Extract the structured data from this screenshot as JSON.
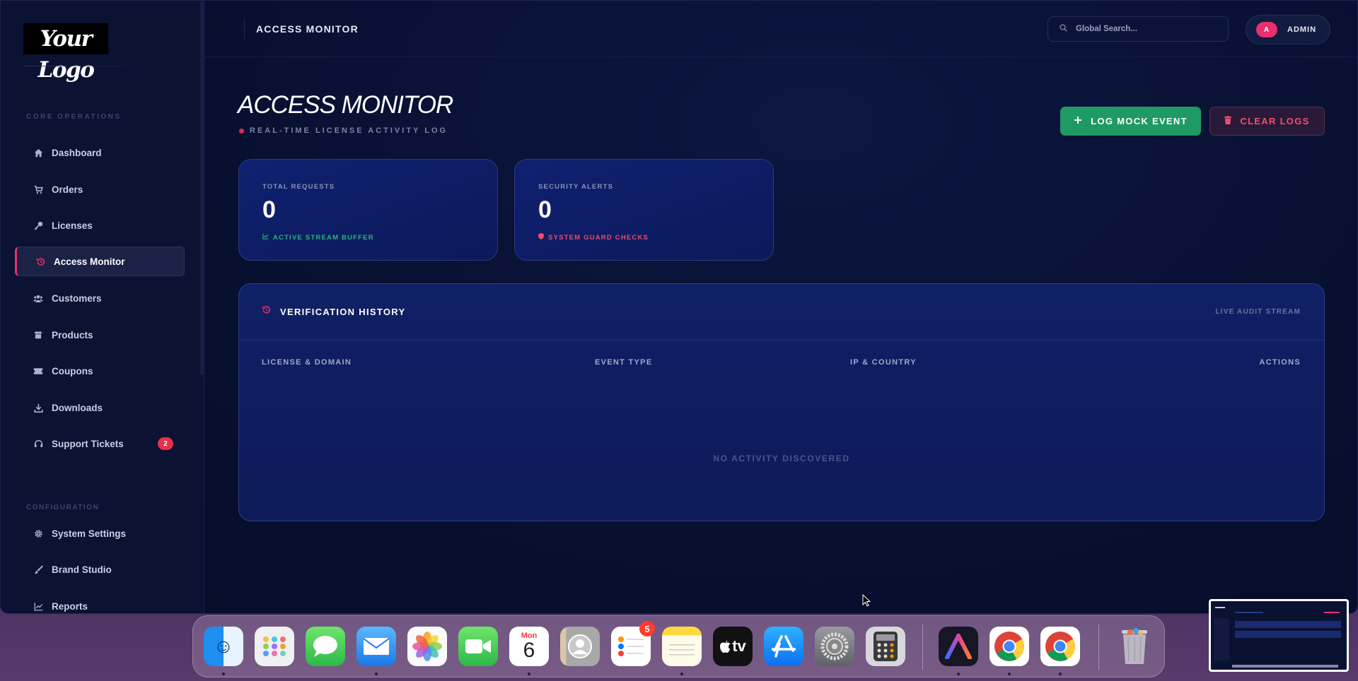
{
  "app": {
    "logo_text": "Your Logo"
  },
  "sidebar": {
    "section_core": "CORE OPERATIONS",
    "section_config": "CONFIGURATION",
    "items": [
      {
        "label": "Dashboard",
        "icon": "home-icon"
      },
      {
        "label": "Orders",
        "icon": "cart-icon"
      },
      {
        "label": "Licenses",
        "icon": "key-icon"
      },
      {
        "label": "Access Monitor",
        "icon": "history-icon",
        "active": true
      },
      {
        "label": "Customers",
        "icon": "users-icon"
      },
      {
        "label": "Products",
        "icon": "box-icon"
      },
      {
        "label": "Coupons",
        "icon": "ticket-icon"
      },
      {
        "label": "Downloads",
        "icon": "download-icon"
      },
      {
        "label": "Support Tickets",
        "icon": "headset-icon",
        "badge": "2"
      }
    ],
    "config_items": [
      {
        "label": "System Settings",
        "icon": "gear-icon"
      },
      {
        "label": "Brand Studio",
        "icon": "brush-icon"
      },
      {
        "label": "Reports",
        "icon": "chart-line-icon"
      }
    ]
  },
  "header": {
    "title": "ACCESS MONITOR",
    "search_placeholder": "Global Search...",
    "user_initial": "A",
    "user_label": "ADMIN"
  },
  "main": {
    "title": "ACCESS MONITOR",
    "subtitle": "REAL-TIME LICENSE ACTIVITY LOG",
    "log_button": "LOG MOCK EVENT",
    "clear_button": "CLEAR LOGS",
    "stats": [
      {
        "label": "TOTAL REQUESTS",
        "value": "0",
        "meta": "ACTIVE STREAM BUFFER"
      },
      {
        "label": "SECURITY ALERTS",
        "value": "0",
        "meta": "SYSTEM GUARD CHECKS"
      }
    ],
    "panel": {
      "title": "VERIFICATION HISTORY",
      "right_label": "LIVE AUDIT STREAM",
      "columns": [
        "LICENSE & DOMAIN",
        "EVENT TYPE",
        "IP & COUNTRY",
        "ACTIONS"
      ],
      "empty_text": "NO ACTIVITY DISCOVERED"
    }
  },
  "dock": {
    "calendar_month": "Mon",
    "calendar_day": "6",
    "reminders_badge": "5",
    "tv_label": "tv",
    "apps": [
      "Finder",
      "Launchpad",
      "Messages",
      "Mail",
      "Photos",
      "FaceTime",
      "Calendar",
      "Contacts",
      "Reminders",
      "Notes",
      "TV",
      "App Store",
      "System Settings",
      "Calculator",
      "Arc",
      "Chrome",
      "Chrome",
      "Trash"
    ]
  },
  "colors": {
    "accent": "#e8306e",
    "success": "#1f9a63",
    "danger": "#f0506a",
    "background": "#081030"
  }
}
